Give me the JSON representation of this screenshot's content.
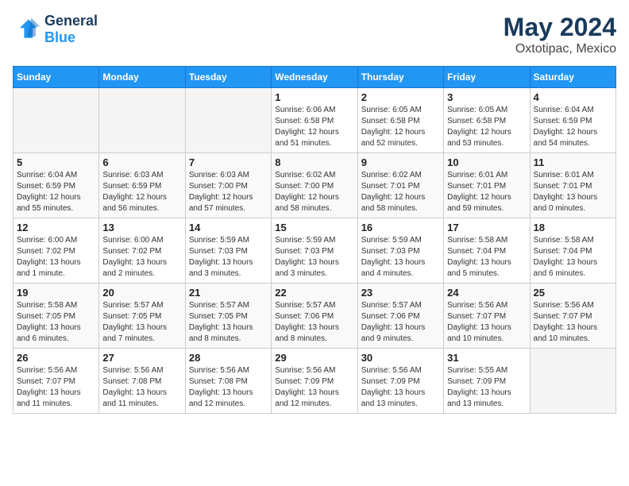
{
  "header": {
    "logo_line1": "General",
    "logo_line2": "Blue",
    "month": "May 2024",
    "location": "Oxtotipac, Mexico"
  },
  "weekdays": [
    "Sunday",
    "Monday",
    "Tuesday",
    "Wednesday",
    "Thursday",
    "Friday",
    "Saturday"
  ],
  "weeks": [
    [
      {
        "day": "",
        "info": ""
      },
      {
        "day": "",
        "info": ""
      },
      {
        "day": "",
        "info": ""
      },
      {
        "day": "1",
        "info": "Sunrise: 6:06 AM\nSunset: 6:58 PM\nDaylight: 12 hours\nand 51 minutes."
      },
      {
        "day": "2",
        "info": "Sunrise: 6:05 AM\nSunset: 6:58 PM\nDaylight: 12 hours\nand 52 minutes."
      },
      {
        "day": "3",
        "info": "Sunrise: 6:05 AM\nSunset: 6:58 PM\nDaylight: 12 hours\nand 53 minutes."
      },
      {
        "day": "4",
        "info": "Sunrise: 6:04 AM\nSunset: 6:59 PM\nDaylight: 12 hours\nand 54 minutes."
      }
    ],
    [
      {
        "day": "5",
        "info": "Sunrise: 6:04 AM\nSunset: 6:59 PM\nDaylight: 12 hours\nand 55 minutes."
      },
      {
        "day": "6",
        "info": "Sunrise: 6:03 AM\nSunset: 6:59 PM\nDaylight: 12 hours\nand 56 minutes."
      },
      {
        "day": "7",
        "info": "Sunrise: 6:03 AM\nSunset: 7:00 PM\nDaylight: 12 hours\nand 57 minutes."
      },
      {
        "day": "8",
        "info": "Sunrise: 6:02 AM\nSunset: 7:00 PM\nDaylight: 12 hours\nand 58 minutes."
      },
      {
        "day": "9",
        "info": "Sunrise: 6:02 AM\nSunset: 7:01 PM\nDaylight: 12 hours\nand 58 minutes."
      },
      {
        "day": "10",
        "info": "Sunrise: 6:01 AM\nSunset: 7:01 PM\nDaylight: 12 hours\nand 59 minutes."
      },
      {
        "day": "11",
        "info": "Sunrise: 6:01 AM\nSunset: 7:01 PM\nDaylight: 13 hours\nand 0 minutes."
      }
    ],
    [
      {
        "day": "12",
        "info": "Sunrise: 6:00 AM\nSunset: 7:02 PM\nDaylight: 13 hours\nand 1 minute."
      },
      {
        "day": "13",
        "info": "Sunrise: 6:00 AM\nSunset: 7:02 PM\nDaylight: 13 hours\nand 2 minutes."
      },
      {
        "day": "14",
        "info": "Sunrise: 5:59 AM\nSunset: 7:03 PM\nDaylight: 13 hours\nand 3 minutes."
      },
      {
        "day": "15",
        "info": "Sunrise: 5:59 AM\nSunset: 7:03 PM\nDaylight: 13 hours\nand 3 minutes."
      },
      {
        "day": "16",
        "info": "Sunrise: 5:59 AM\nSunset: 7:03 PM\nDaylight: 13 hours\nand 4 minutes."
      },
      {
        "day": "17",
        "info": "Sunrise: 5:58 AM\nSunset: 7:04 PM\nDaylight: 13 hours\nand 5 minutes."
      },
      {
        "day": "18",
        "info": "Sunrise: 5:58 AM\nSunset: 7:04 PM\nDaylight: 13 hours\nand 6 minutes."
      }
    ],
    [
      {
        "day": "19",
        "info": "Sunrise: 5:58 AM\nSunset: 7:05 PM\nDaylight: 13 hours\nand 6 minutes."
      },
      {
        "day": "20",
        "info": "Sunrise: 5:57 AM\nSunset: 7:05 PM\nDaylight: 13 hours\nand 7 minutes."
      },
      {
        "day": "21",
        "info": "Sunrise: 5:57 AM\nSunset: 7:05 PM\nDaylight: 13 hours\nand 8 minutes."
      },
      {
        "day": "22",
        "info": "Sunrise: 5:57 AM\nSunset: 7:06 PM\nDaylight: 13 hours\nand 8 minutes."
      },
      {
        "day": "23",
        "info": "Sunrise: 5:57 AM\nSunset: 7:06 PM\nDaylight: 13 hours\nand 9 minutes."
      },
      {
        "day": "24",
        "info": "Sunrise: 5:56 AM\nSunset: 7:07 PM\nDaylight: 13 hours\nand 10 minutes."
      },
      {
        "day": "25",
        "info": "Sunrise: 5:56 AM\nSunset: 7:07 PM\nDaylight: 13 hours\nand 10 minutes."
      }
    ],
    [
      {
        "day": "26",
        "info": "Sunrise: 5:56 AM\nSunset: 7:07 PM\nDaylight: 13 hours\nand 11 minutes."
      },
      {
        "day": "27",
        "info": "Sunrise: 5:56 AM\nSunset: 7:08 PM\nDaylight: 13 hours\nand 11 minutes."
      },
      {
        "day": "28",
        "info": "Sunrise: 5:56 AM\nSunset: 7:08 PM\nDaylight: 13 hours\nand 12 minutes."
      },
      {
        "day": "29",
        "info": "Sunrise: 5:56 AM\nSunset: 7:09 PM\nDaylight: 13 hours\nand 12 minutes."
      },
      {
        "day": "30",
        "info": "Sunrise: 5:56 AM\nSunset: 7:09 PM\nDaylight: 13 hours\nand 13 minutes."
      },
      {
        "day": "31",
        "info": "Sunrise: 5:55 AM\nSunset: 7:09 PM\nDaylight: 13 hours\nand 13 minutes."
      },
      {
        "day": "",
        "info": ""
      }
    ]
  ]
}
